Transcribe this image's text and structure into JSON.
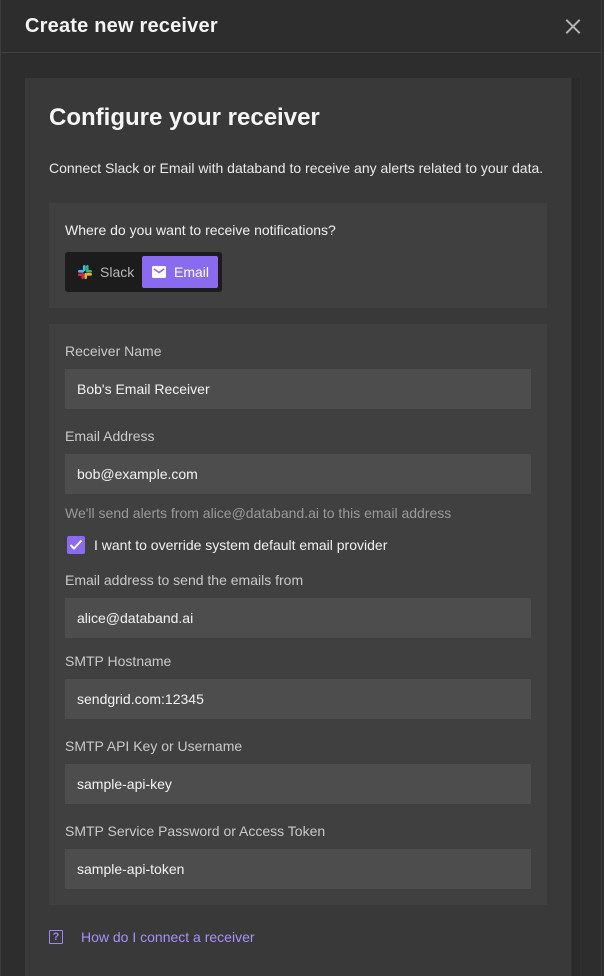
{
  "modal": {
    "title": "Create new receiver",
    "close_icon": "close-icon"
  },
  "content": {
    "title": "Configure your receiver",
    "description": "Connect Slack or Email with databand to receive any alerts related to your data."
  },
  "channel_selector": {
    "question": "Where do you want to receive notifications?",
    "options": [
      {
        "label": "Slack",
        "icon": "slack-icon",
        "selected": false
      },
      {
        "label": "Email",
        "icon": "mail-icon",
        "selected": true
      }
    ]
  },
  "form": {
    "receiver_name": {
      "label": "Receiver Name",
      "value": "Bob's Email Receiver"
    },
    "email_address": {
      "label": "Email Address",
      "value": "bob@example.com",
      "helper": "We'll send alerts from alice@databand.ai to this email address"
    },
    "override_checkbox": {
      "label": "I want to override system default email provider",
      "checked": true
    },
    "from_email": {
      "label": "Email address to send the emails from",
      "value": "alice@databand.ai"
    },
    "smtp_hostname": {
      "label": "SMTP Hostname",
      "value": "sendgrid.com:12345"
    },
    "smtp_api_key": {
      "label": "SMTP API Key or Username",
      "value": "sample-api-key"
    },
    "smtp_password": {
      "label": "SMTP Service Password or Access Token",
      "value": "sample-api-token"
    }
  },
  "help": {
    "icon": "question-icon",
    "link_text": "How do I connect a receiver"
  },
  "colors": {
    "accent": "#8a6bf0",
    "link": "#a691f7"
  }
}
